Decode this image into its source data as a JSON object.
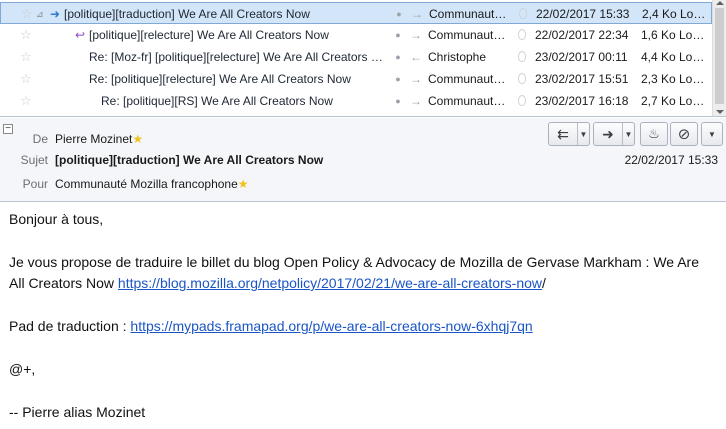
{
  "message_list": {
    "rows": [
      {
        "subject": "[politique][traduction] We Are All Creators Now",
        "correspondent": "Communaut…",
        "date": "22/02/2017 15:33",
        "size": "2,4 Ko",
        "location": "Lo…",
        "corr_icon": "→",
        "subject_icon": "fwd-icon",
        "selected": true
      },
      {
        "subject": "[politique][relecture] We Are All Creators Now",
        "correspondent": "Communaut…",
        "date": "22/02/2017 22:34",
        "size": "1,6 Ko",
        "location": "Lo…",
        "corr_icon": "→",
        "subject_icon": "reply-icon",
        "selected": false
      },
      {
        "subject": "Re: [Moz-fr] [politique][relecture] We Are All Creators …",
        "correspondent": "Christophe",
        "date": "23/02/2017 00:11",
        "size": "4,4 Ko",
        "location": "Lo…",
        "corr_icon": "←",
        "subject_icon": "",
        "selected": false
      },
      {
        "subject": "Re: [politique][relecture] We Are All Creators Now",
        "correspondent": "Communaut…",
        "date": "23/02/2017 15:51",
        "size": "2,3 Ko",
        "location": "Lo…",
        "corr_icon": "→",
        "subject_icon": "",
        "selected": false
      },
      {
        "subject": "Re: [politique][RS] We Are All Creators Now",
        "correspondent": "Communaut…",
        "date": "23/02/2017 16:18",
        "size": "2,7 Ko",
        "location": "Lo…",
        "corr_icon": "→",
        "subject_icon": "",
        "selected": false
      }
    ]
  },
  "header": {
    "from_label": "De",
    "from_value": "Pierre Mozinet",
    "subject_label": "Sujet",
    "subject_value": "[politique][traduction] We Are All Creators Now",
    "date_value": "22/02/2017 15:33",
    "to_label": "Pour",
    "to_value": "Communauté Mozilla francophone",
    "toolbar": {
      "reply_icon": "reply-all-icon",
      "forward_icon": "forward-icon",
      "junk_icon": "junk-flame-icon",
      "delete_icon": "block-delete-icon",
      "more_icon": "more-dropdown-icon"
    }
  },
  "body": {
    "greeting": "Bonjour à tous,",
    "para1_text": "Je vous propose de traduire le billet du blog Open Policy & Advocacy de Mozilla de Gervase Markham : We Are All Creators Now ",
    "para1_link": "https://blog.mozilla.org/netpolicy/2017/02/21/we-are-all-creators-now",
    "para1_tail": "/",
    "pad_label": "Pad de traduction : ",
    "pad_link": "https://mypads.framapad.org/p/we-are-all-creators-now-6xhqj7qn",
    "closing": "@+,",
    "signature": "-- Pierre alias Mozinet"
  },
  "colors": {
    "selection": "#d3e5f8",
    "link": "#1a55c5",
    "star": "#f1c21b"
  }
}
